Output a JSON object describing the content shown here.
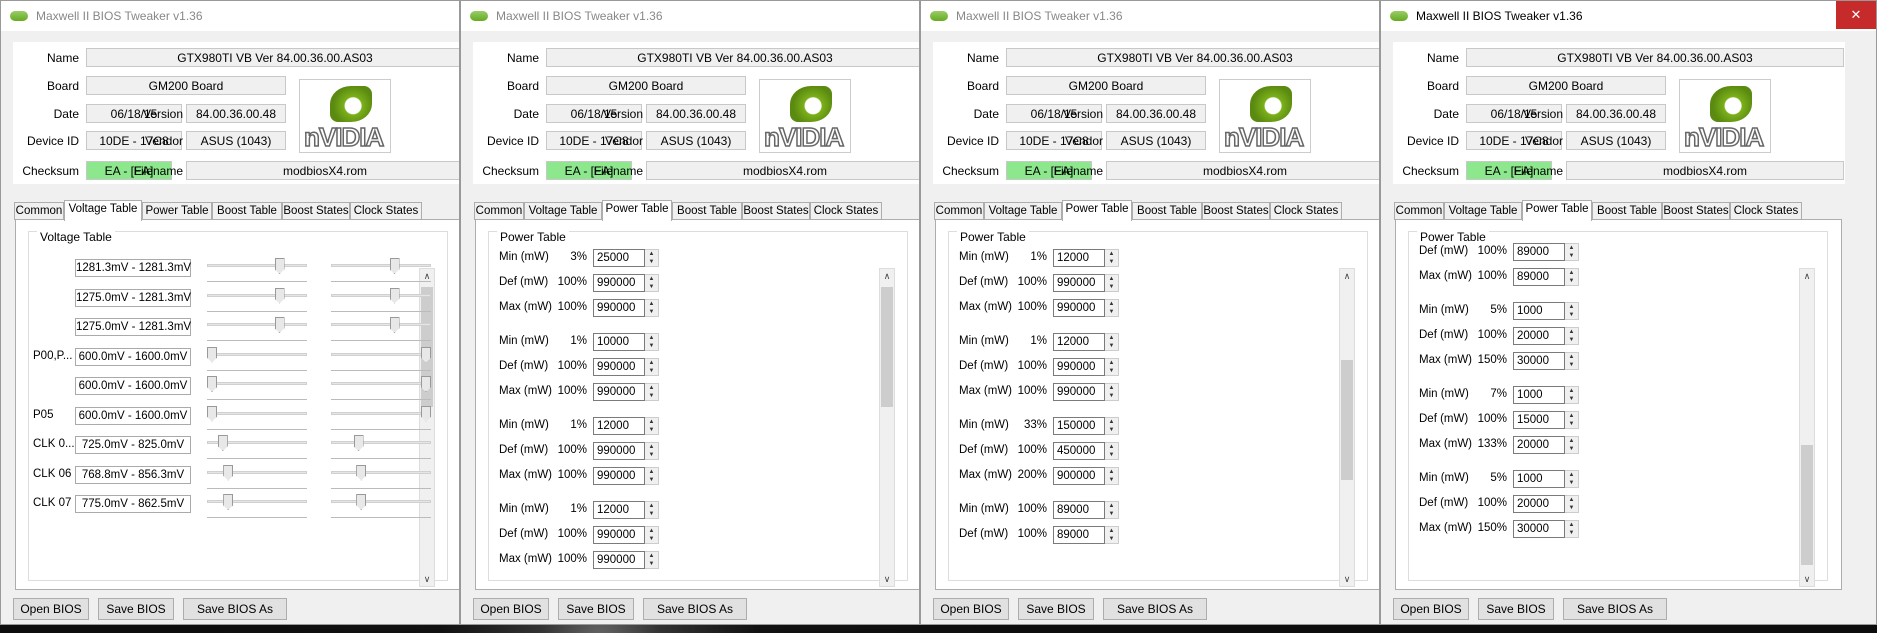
{
  "app": {
    "title": "Maxwell II BIOS Tweaker v1.36",
    "close_symbol": "✕",
    "labels": {
      "name": "Name",
      "board": "Board",
      "date": "Date",
      "version": "Version",
      "device_id": "Device ID",
      "vendor": "Vendor",
      "checksum": "Checksum",
      "filename": "Filename"
    },
    "values": {
      "name": "GTX980TI VB Ver 84.00.36.00.AS03",
      "board": "GM200 Board",
      "date": "06/18/15",
      "version": "84.00.36.00.48",
      "device_id": "10DE - 17C8",
      "vendor": "ASUS (1043)",
      "checksum": "EA - [EA]",
      "filename": "modbiosX4.rom"
    },
    "logo_text": "nVIDIA",
    "tabs": [
      "Common",
      "Voltage Table",
      "Power Table",
      "Boost Table",
      "Boost States",
      "Clock States"
    ],
    "buttons": {
      "open": "Open BIOS",
      "save": "Save BIOS",
      "save_as": "Save BIOS As"
    },
    "checksum_color": "#8de88d"
  },
  "windows": [
    {
      "id": "w1",
      "active": false,
      "selected_tab": "Voltage Table",
      "group_title": "Voltage Table",
      "voltage_rows": [
        {
          "label": "",
          "value": "1281.3mV - 1281.3mV",
          "slider1": 0.75,
          "slider2": 0.65
        },
        {
          "label": "",
          "value": "1275.0mV - 1281.3mV",
          "slider1": 0.75,
          "slider2": 0.65
        },
        {
          "label": "",
          "value": "1275.0mV - 1281.3mV",
          "slider1": 0.75,
          "slider2": 0.65
        },
        {
          "label": "P00,P...",
          "value": "600.0mV - 1600.0mV",
          "slider1": 0.0,
          "slider2": 1.0
        },
        {
          "label": "",
          "value": "600.0mV - 1600.0mV",
          "slider1": 0.0,
          "slider2": 1.0
        },
        {
          "label": "P05",
          "value": "600.0mV - 1600.0mV",
          "slider1": 0.0,
          "slider2": 1.0
        },
        {
          "label": "CLK 0...",
          "value": "725.0mV - 825.0mV",
          "slider1": 0.12,
          "slider2": 0.25
        },
        {
          "label": "CLK 06",
          "value": "768.8mV - 856.3mV",
          "slider1": 0.18,
          "slider2": 0.28
        },
        {
          "label": "CLK 07",
          "value": "775.0mV - 862.5mV",
          "slider1": 0.18,
          "slider2": 0.28
        }
      ],
      "scroll_position": 0.02
    },
    {
      "id": "w2",
      "active": false,
      "selected_tab": "Power Table",
      "group_title": "Power Table",
      "power_rows": [
        {
          "label": "Min (mW)",
          "pct": "3%",
          "value": "25000"
        },
        {
          "label": "Def (mW)",
          "pct": "100%",
          "value": "990000"
        },
        {
          "label": "Max (mW)",
          "pct": "100%",
          "value": "990000"
        },
        {
          "label": "Min (mW)",
          "pct": "1%",
          "value": "10000"
        },
        {
          "label": "Def (mW)",
          "pct": "100%",
          "value": "990000"
        },
        {
          "label": "Max (mW)",
          "pct": "100%",
          "value": "990000"
        },
        {
          "label": "Min (mW)",
          "pct": "1%",
          "value": "12000"
        },
        {
          "label": "Def (mW)",
          "pct": "100%",
          "value": "990000"
        },
        {
          "label": "Max (mW)",
          "pct": "100%",
          "value": "990000"
        },
        {
          "label": "Min (mW)",
          "pct": "1%",
          "value": "12000"
        },
        {
          "label": "Def (mW)",
          "pct": "100%",
          "value": "990000"
        },
        {
          "label": "Max (mW)",
          "pct": "100%",
          "value": "990000"
        }
      ],
      "scroll_position": 0.02
    },
    {
      "id": "w3",
      "active": false,
      "selected_tab": "Power Table",
      "group_title": "Power Table",
      "power_rows": [
        {
          "label": "Min (mW)",
          "pct": "1%",
          "value": "12000"
        },
        {
          "label": "Def (mW)",
          "pct": "100%",
          "value": "990000"
        },
        {
          "label": "Max (mW)",
          "pct": "100%",
          "value": "990000"
        },
        {
          "label": "Min (mW)",
          "pct": "1%",
          "value": "12000"
        },
        {
          "label": "Def (mW)",
          "pct": "100%",
          "value": "990000"
        },
        {
          "label": "Max (mW)",
          "pct": "100%",
          "value": "990000"
        },
        {
          "label": "Min (mW)",
          "pct": "33%",
          "value": "150000"
        },
        {
          "label": "Def (mW)",
          "pct": "100%",
          "value": "450000"
        },
        {
          "label": "Max (mW)",
          "pct": "200%",
          "value": "900000"
        },
        {
          "label": "Min (mW)",
          "pct": "100%",
          "value": "89000"
        },
        {
          "label": "Def (mW)",
          "pct": "100%",
          "value": "89000"
        }
      ],
      "scroll_position": 0.45
    },
    {
      "id": "w4",
      "active": true,
      "selected_tab": "Power Table",
      "group_title": "Power Table",
      "power_rows": [
        {
          "label": "Def (mW)",
          "pct": "100%",
          "value": "89000"
        },
        {
          "label": "Max (mW)",
          "pct": "100%",
          "value": "89000"
        },
        {
          "label": "Min (mW)",
          "pct": "5%",
          "value": "1000"
        },
        {
          "label": "Def (mW)",
          "pct": "100%",
          "value": "20000"
        },
        {
          "label": "Max (mW)",
          "pct": "150%",
          "value": "30000"
        },
        {
          "label": "Min (mW)",
          "pct": "7%",
          "value": "1000"
        },
        {
          "label": "Def (mW)",
          "pct": "100%",
          "value": "15000"
        },
        {
          "label": "Max (mW)",
          "pct": "133%",
          "value": "20000"
        },
        {
          "label": "Min (mW)",
          "pct": "5%",
          "value": "1000"
        },
        {
          "label": "Def (mW)",
          "pct": "100%",
          "value": "20000"
        },
        {
          "label": "Max (mW)",
          "pct": "150%",
          "value": "30000"
        }
      ],
      "scroll_position": 0.95
    }
  ]
}
